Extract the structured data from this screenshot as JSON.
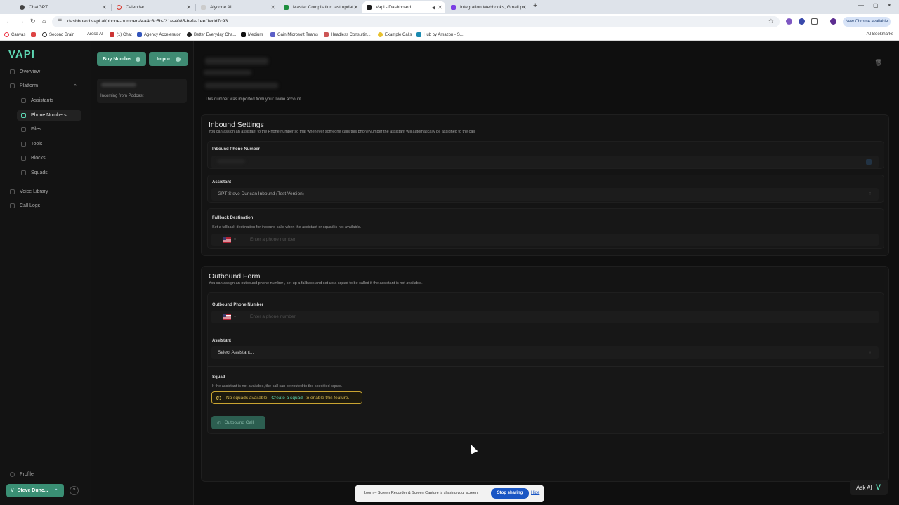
{
  "browser": {
    "tabs": [
      {
        "title": "ChatGPT",
        "active": false
      },
      {
        "title": "Calendar",
        "active": false
      },
      {
        "title": "Alycone AI",
        "active": false
      },
      {
        "title": "Master Compilation last updat",
        "active": false
      },
      {
        "title": "Vapi - Dashboard",
        "active": true
      },
      {
        "title": "Integration Webhooks, Gmail p",
        "active": false
      }
    ],
    "url": "dashboard.vapi.ai/phone-numbers/4a4c3c5b-f21e-4085-befa-1eef1edd7c93",
    "chrome_update_label": "New Chrome available",
    "bookmarks": [
      "Canvas",
      "Second Brain",
      "Arose AI",
      "(1) Chat",
      "Agency Accelerator",
      "Better Everyday Cha...",
      "Medium",
      "Gain Microsoft Teams",
      "Headless Consultin...",
      "Example Calls",
      "Hub by Amazon - S..."
    ],
    "all_bookmarks": "All Bookmarks"
  },
  "sidebar": {
    "logo": "VAPI",
    "items": [
      {
        "label": "Overview"
      },
      {
        "label": "Platform"
      },
      {
        "label": "Assistants"
      },
      {
        "label": "Phone Numbers"
      },
      {
        "label": "Files"
      },
      {
        "label": "Tools"
      },
      {
        "label": "Blocks"
      },
      {
        "label": "Squads"
      },
      {
        "label": "Voice Library"
      },
      {
        "label": "Call Logs"
      }
    ],
    "profile": "Profile",
    "user": "Steve Dunc..."
  },
  "list": {
    "buy_label": "Buy Number",
    "import_label": "Import",
    "card_sub": "Incoming from Podcast"
  },
  "main": {
    "imported_note": "This number was imported from your Twilio account.",
    "inbound": {
      "title": "Inbound Settings",
      "desc": "You can assign an assistant to the Phone number so that whenever someone calls this phoneNumber the assistant will automatically be assigned to the call.",
      "phone_label": "Inbound Phone Number",
      "assistant_label": "Assistant",
      "assistant_value": "GPT-Steve Duncan Inbound (Test Version)",
      "fallback_label": "Fallback Destination",
      "fallback_hint": "Set a fallback destination for inbound calls when the assistant or squad is not available.",
      "fallback_placeholder": "Enter a phone number"
    },
    "outbound": {
      "title": "Outbound Form",
      "desc": "You can assign an outbound phone number , set up a fallback and set up a squad to be called if the assistant is not available.",
      "phone_label": "Outbound Phone Number",
      "phone_placeholder": "Enter a phone number",
      "assistant_label": "Assistant",
      "assistant_value": "Select Assistant...",
      "squad_label": "Squad",
      "squad_hint": "If the assistant is not available, the call can be routed to the specified squad.",
      "warn_prefix": "No squads available.",
      "warn_link": "Create a squad",
      "warn_suffix": "to enable this feature.",
      "call_button": "Outbound Call"
    }
  },
  "loom": {
    "text": "Loom – Screen Recorder & Screen Capture is sharing your screen.",
    "stop": "Stop sharing",
    "hide": "Hide"
  },
  "ask_ai": "Ask AI"
}
